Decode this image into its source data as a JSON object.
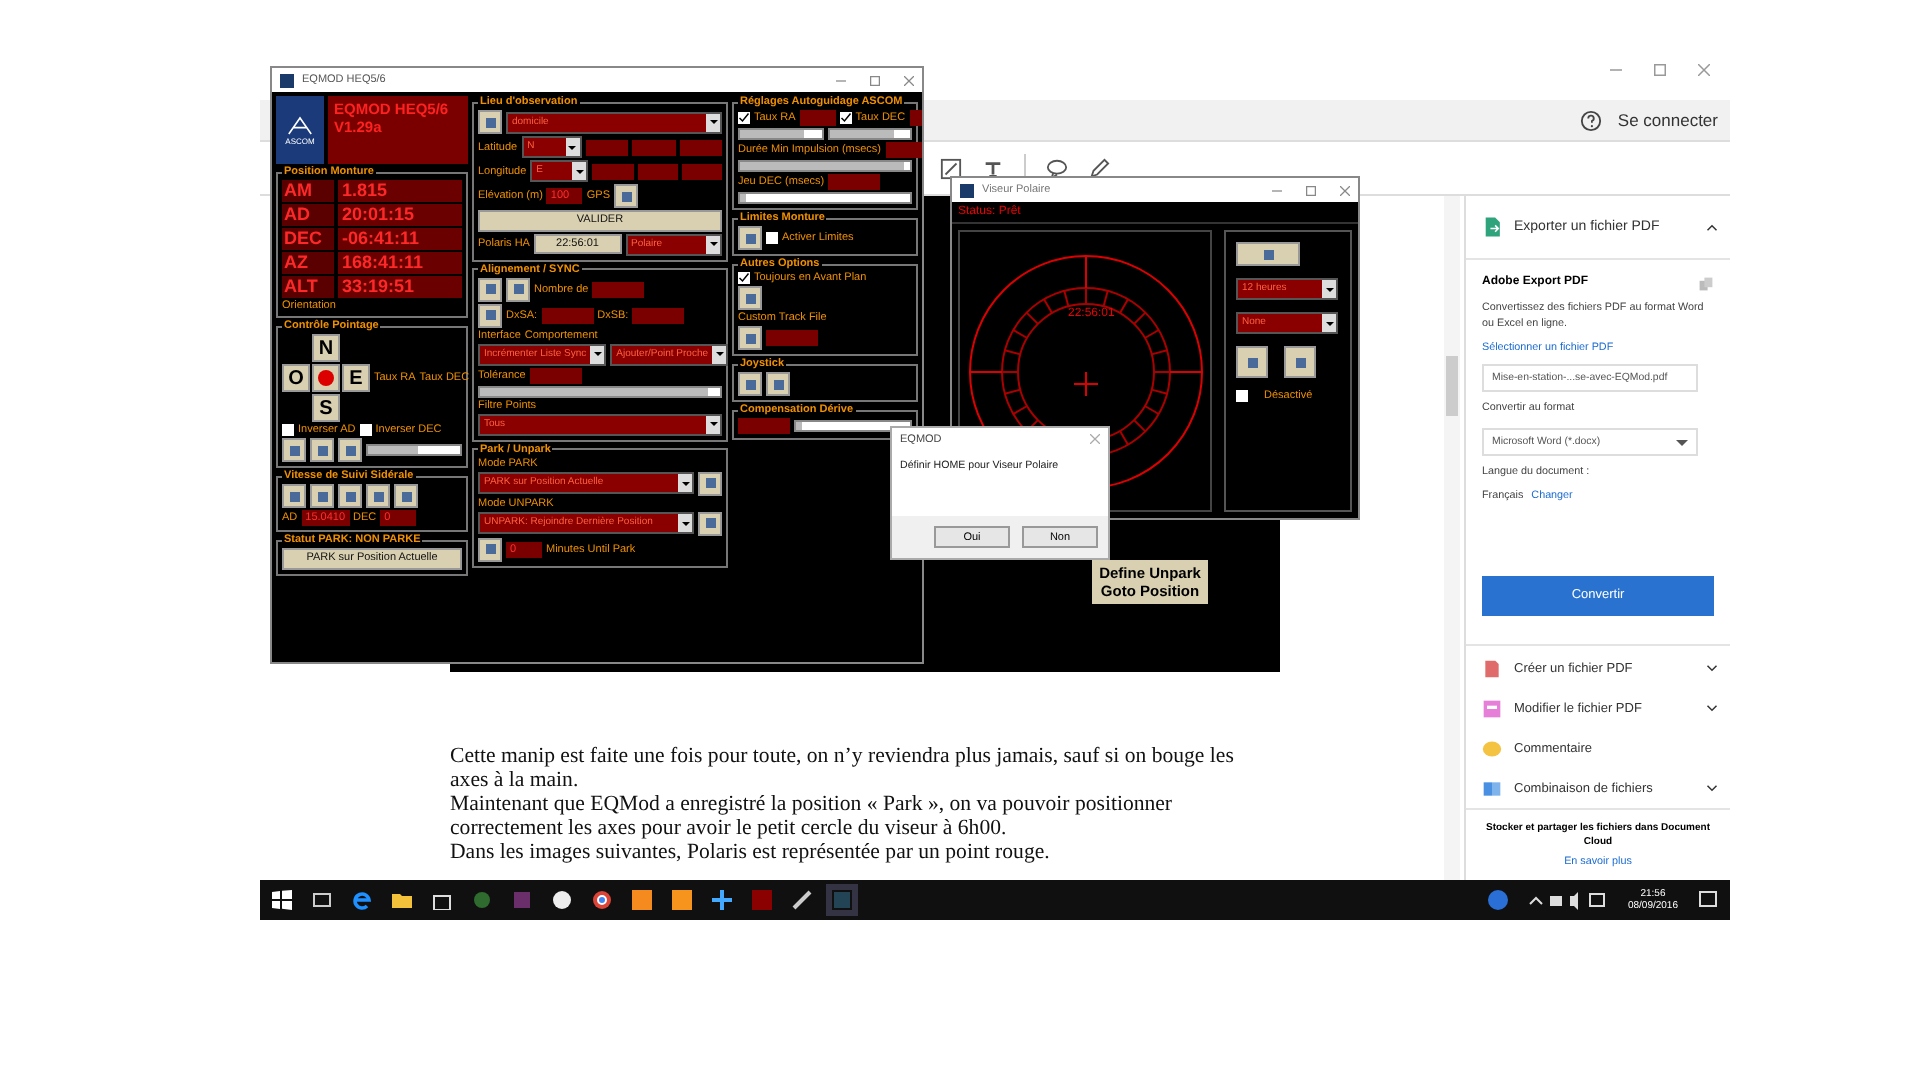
{
  "acrobat": {
    "sign_in": "Se connecter",
    "embedded_button": "Define Unpark Goto Position",
    "paragraphs": [
      "Cette manip est faite une fois pour toute, on n’y reviendra plus jamais, sauf si on bouge les axes à la main.",
      "Maintenant que EQMod a enregistré la position « Park », on va pouvoir positionner correctement les axes pour avoir le petit cercle du viseur à 6h00.",
      "Dans les images suivantes, Polaris est représentée par un point rouge."
    ],
    "panel": {
      "export_title": "Exporter un fichier PDF",
      "service": "Adobe Export PDF",
      "description": "Convertissez des fichiers PDF au format Word ou Excel en ligne.",
      "select_link": "Sélectionner un fichier PDF",
      "file": "Mise-en-station-...se-avec-EQMod.pdf",
      "format_label": "Convertir au format",
      "format": "Microsoft Word (*.docx)",
      "language_label": "Langue du document :",
      "language": "Français",
      "change_link": "Changer",
      "convert": "Convertir",
      "tools": [
        {
          "kind": "create",
          "label": "Créer un fichier PDF"
        },
        {
          "kind": "edit",
          "label": "Modifier le fichier PDF"
        },
        {
          "kind": "comment",
          "label": "Commentaire"
        },
        {
          "kind": "combine",
          "label": "Combinaison de fichiers"
        }
      ],
      "footer": "Stocker et partager les fichiers dans Document Cloud",
      "learn_more": "En savoir plus"
    }
  },
  "eqmod": {
    "title": "EQMOD HEQ5/6",
    "header": [
      "EQMOD HEQ5/6",
      "V1.29a"
    ],
    "logo": "ASCOM",
    "columns": [
      [
        {
          "title": "Position Monture",
          "rows": [
            [
              {
                "kind": "readout",
                "label": "AM",
                "value": "1.815"
              }
            ],
            [
              {
                "kind": "readout",
                "label": "AD",
                "value": "20:01:15"
              }
            ],
            [
              {
                "kind": "readout",
                "label": "DEC",
                "value": "-06:41:11"
              }
            ],
            [
              {
                "kind": "readout",
                "label": "AZ",
                "value": "168:41:11"
              }
            ],
            [
              {
                "kind": "readout",
                "label": "ALT",
                "value": "33:19:51"
              }
            ],
            [
              {
                "kind": "text",
                "text": "Orientation"
              }
            ]
          ]
        },
        {
          "title": "Contrôle Pointage",
          "rows": [
            [
              {
                "kind": "pad",
                "keys": [
                  "N",
                  "O",
                  "E",
                  "S"
                ]
              },
              {
                "kind": "text",
                "text": "Taux RA"
              },
              {
                "kind": "text",
                "text": "Taux DEC"
              }
            ],
            [
              {
                "kind": "check",
                "label": "Inverser AD",
                "checked": false
              },
              {
                "kind": "check",
                "label": "Inverser DEC",
                "checked": false
              }
            ],
            [
              {
                "kind": "icon"
              },
              {
                "kind": "icon"
              },
              {
                "kind": "icon"
              },
              {
                "kind": "slider",
                "level": 0.55
              }
            ]
          ]
        },
        {
          "title": "Vitesse de Suivi Sidérale",
          "rows": [
            [
              {
                "kind": "icon"
              },
              {
                "kind": "icon"
              },
              {
                "kind": "icon"
              },
              {
                "kind": "icon"
              },
              {
                "kind": "icon"
              }
            ],
            [
              {
                "kind": "text",
                "text": "AD"
              },
              {
                "kind": "value",
                "value": "15.0410"
              },
              {
                "kind": "text",
                "text": "DEC"
              },
              {
                "kind": "value",
                "value": "0"
              }
            ]
          ]
        },
        {
          "title": "Statut PARK: NON PARKE",
          "rows": [
            [
              {
                "kind": "button",
                "label": "PARK sur Position Actuelle"
              }
            ]
          ]
        }
      ],
      [
        {
          "title": "Lieu d'observation",
          "rows": [
            [
              {
                "kind": "icon"
              },
              {
                "kind": "select",
                "value": "domicile"
              }
            ],
            [
              {
                "kind": "text",
                "text": "Latitude"
              },
              {
                "kind": "select",
                "value": "N"
              },
              {
                "kind": "blank"
              },
              {
                "kind": "blank"
              },
              {
                "kind": "blank"
              }
            ],
            [
              {
                "kind": "text",
                "text": "Longitude"
              },
              {
                "kind": "select",
                "value": "E"
              },
              {
                "kind": "blank"
              },
              {
                "kind": "blank"
              },
              {
                "kind": "blank"
              }
            ],
            [
              {
                "kind": "text",
                "text": "Elévation (m)"
              },
              {
                "kind": "value",
                "value": "100"
              },
              {
                "kind": "text",
                "text": "GPS"
              },
              {
                "kind": "icon"
              }
            ],
            [
              {
                "kind": "button",
                "label": "VALIDER"
              }
            ],
            [
              {
                "kind": "text",
                "text": "Polaris HA"
              },
              {
                "kind": "button",
                "label": "22:56:01"
              },
              {
                "kind": "select",
                "value": "Polaire"
              }
            ]
          ]
        },
        {
          "title": "Alignement / SYNC",
          "rows": [
            [
              {
                "kind": "icon"
              },
              {
                "kind": "icon"
              },
              {
                "kind": "text",
                "text": "Nombre de"
              },
              {
                "kind": "blank"
              }
            ],
            [
              {
                "kind": "icon"
              },
              {
                "kind": "text",
                "text": "DxSA:"
              },
              {
                "kind": "blank"
              },
              {
                "kind": "text",
                "text": "DxSB:"
              },
              {
                "kind": "blank"
              }
            ],
            [
              {
                "kind": "text",
                "text": "Interface"
              },
              {
                "kind": "text",
                "text": "Comportement"
              }
            ],
            [
              {
                "kind": "select",
                "value": "Incrémenter Liste Sync"
              },
              {
                "kind": "select",
                "value": "Ajouter/Point Proche"
              }
            ],
            [
              {
                "kind": "text",
                "text": "Tolérance"
              },
              {
                "kind": "blank"
              }
            ],
            [
              {
                "kind": "slider",
                "level": 0.95
              }
            ],
            [
              {
                "kind": "text",
                "text": "Filtre Points"
              }
            ],
            [
              {
                "kind": "select",
                "value": "Tous"
              }
            ]
          ]
        },
        {
          "title": "Park / Unpark",
          "rows": [
            [
              {
                "kind": "text",
                "text": "Mode PARK"
              }
            ],
            [
              {
                "kind": "select",
                "value": "PARK sur Position Actuelle"
              },
              {
                "kind": "icon"
              }
            ],
            [
              {
                "kind": "text",
                "text": "Mode UNPARK"
              }
            ],
            [
              {
                "kind": "select",
                "value": "UNPARK: Rejoindre Dernière Position"
              },
              {
                "kind": "icon"
              }
            ],
            [
              {
                "kind": "icon"
              },
              {
                "kind": "value",
                "value": "0"
              },
              {
                "kind": "text",
                "text": "Minutes Until Park"
              }
            ]
          ]
        }
      ],
      [
        {
          "title": "Réglages Autoguidage ASCOM",
          "rows": [
            [
              {
                "kind": "check",
                "label": "Taux RA",
                "checked": true
              },
              {
                "kind": "blank"
              },
              {
                "kind": "check",
                "label": "Taux DEC",
                "checked": true
              },
              {
                "kind": "blank"
              }
            ],
            [
              {
                "kind": "slider",
                "level": 0.8
              },
              {
                "kind": "slider",
                "level": 0.8
              }
            ],
            [
              {
                "kind": "text",
                "text": "Durée Min Impulsion (msecs)"
              },
              {
                "kind": "blank"
              }
            ],
            [
              {
                "kind": "slider",
                "level": 0.97
              }
            ],
            [
              {
                "kind": "text",
                "text": "Jeu DEC (msecs)"
              },
              {
                "kind": "blank"
              }
            ],
            [
              {
                "kind": "slider",
                "level": 0.03
              }
            ]
          ]
        },
        {
          "title": "Limites Monture",
          "rows": [
            [
              {
                "kind": "icon"
              },
              {
                "kind": "check",
                "label": "Activer Limites",
                "checked": false
              }
            ]
          ]
        },
        {
          "title": "Autres Options",
          "rows": [
            [
              {
                "kind": "check",
                "label": "Toujours en Avant Plan",
                "checked": true
              }
            ],
            [
              {
                "kind": "icon"
              }
            ],
            [
              {
                "kind": "text",
                "text": "Custom Track File"
              }
            ],
            [
              {
                "kind": "icon"
              },
              {
                "kind": "blank"
              }
            ]
          ]
        },
        {
          "title": "Joystick",
          "rows": [
            [
              {
                "kind": "icon"
              },
              {
                "kind": "icon"
              }
            ]
          ]
        },
        {
          "title": "Compensation Dérive",
          "rows": [
            [
              {
                "kind": "blank"
              },
              {
                "kind": "slider",
                "level": 0.05
              }
            ]
          ]
        }
      ]
    ]
  },
  "polar": {
    "title": "Viseur Polaire",
    "status": "Status: Prêt",
    "time": "22:56:01",
    "selects": [
      "12 heures",
      "None"
    ],
    "disabled_label": "Désactivé",
    "disabled": false
  },
  "dialog": {
    "title": "EQMOD",
    "message": "Définir HOME pour Viseur Polaire",
    "buttons": [
      "Oui",
      "Non"
    ]
  },
  "taskbar": {
    "time": "21:56",
    "date": "08/09/2016"
  }
}
